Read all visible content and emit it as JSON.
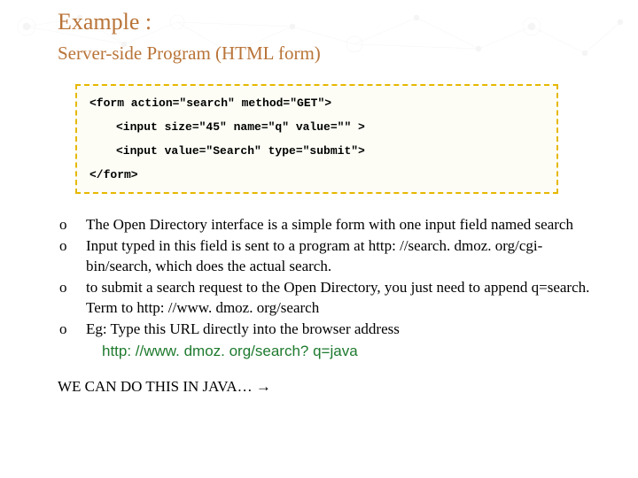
{
  "heading": "Example :",
  "subheading": "Server-side Program (HTML form)",
  "code": {
    "l1": "<form action=\"search\" method=\"GET\">",
    "l2": "<input size=\"45\" name=\"q\" value=\"\" >",
    "l3": "<input value=\"Search\" type=\"submit\">",
    "l4": "</form>"
  },
  "bullets": {
    "marker": "o",
    "b1": "The Open Directory interface is a simple form with one input field named search",
    "b2": "Input typed in this field is sent to a program at http: //search. dmoz. org/cgi-bin/search, which does the actual search.",
    "b3": "to submit a search request to the Open Directory, you just need to append q=search. Term to http: //www. dmoz. org/search",
    "b4": "Eg: Type this URL directly into the browser address",
    "b4_url": "http: //www. dmoz. org/search? q=java"
  },
  "closing": "WE CAN DO THIS IN JAVA… →"
}
